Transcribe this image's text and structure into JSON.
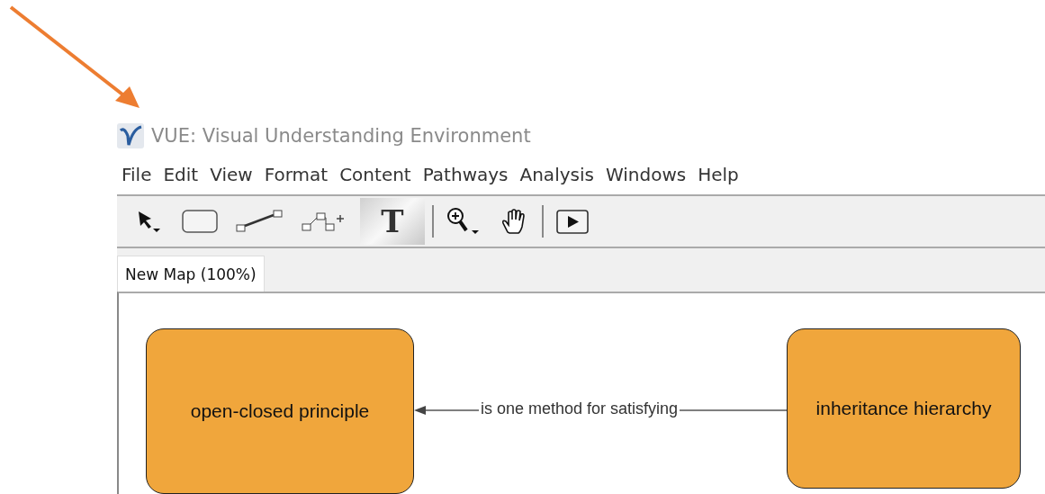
{
  "window": {
    "title": "VUE: Visual Understanding Environment"
  },
  "menu": [
    "File",
    "Edit",
    "View",
    "Format",
    "Content",
    "Pathways",
    "Analysis",
    "Windows",
    "Help"
  ],
  "toolbar": [
    {
      "kind": "pointer",
      "selected": false
    },
    {
      "kind": "node",
      "selected": false
    },
    {
      "kind": "link",
      "selected": false
    },
    {
      "kind": "multilink",
      "selected": false
    },
    {
      "kind": "text",
      "label": "T",
      "selected": true
    },
    {
      "kind": "separator"
    },
    {
      "kind": "zoom",
      "selected": false
    },
    {
      "kind": "hand",
      "selected": false
    },
    {
      "kind": "separator"
    },
    {
      "kind": "play",
      "selected": false
    }
  ],
  "tabs": [
    {
      "label": "New Map (100%)",
      "selected": true
    }
  ],
  "map": {
    "nodes": [
      {
        "label": "open-closed principle",
        "color": "#f0a63c"
      },
      {
        "label": "inheritance hierarchy",
        "color": "#f0a63c"
      }
    ],
    "links": [
      {
        "label": "is one method for satisfying"
      }
    ]
  }
}
